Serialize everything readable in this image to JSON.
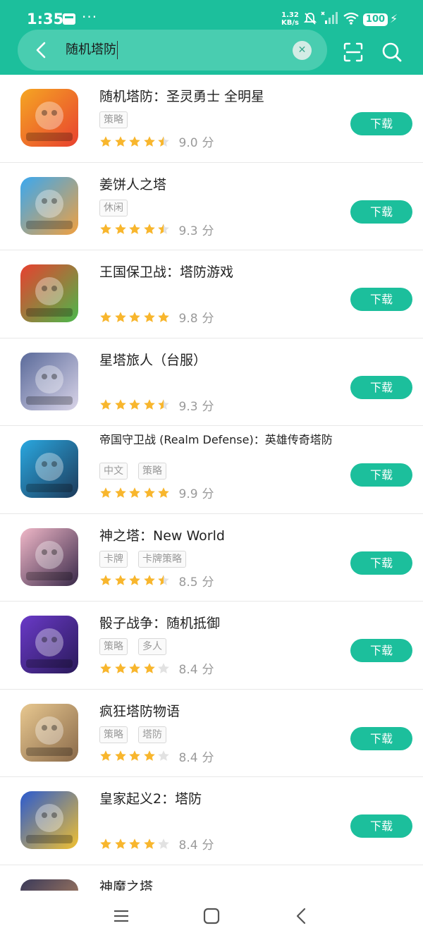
{
  "status": {
    "time": "1:35",
    "speed": "1.32",
    "speed_unit": "KB/s",
    "battery": "100"
  },
  "search": {
    "query": "随机塔防"
  },
  "download_label": "下载",
  "score_unit": "分",
  "apps": [
    {
      "title": "随机塔防：圣灵勇士 全明星",
      "tags": [
        "策略"
      ],
      "rating": 4.5,
      "score": "9.0",
      "icon": "hero-event-icon",
      "colors": [
        "#f5a623",
        "#e8412f"
      ]
    },
    {
      "title": "姜饼人之塔",
      "tags": [
        "休闲"
      ],
      "rating": 4.5,
      "score": "9.3",
      "icon": "gingerbread-adventures-icon",
      "colors": [
        "#3aa8f0",
        "#f0a040"
      ]
    },
    {
      "title": "王国保卫战：塔防游戏",
      "tags": [],
      "rating": 5,
      "score": "9.8",
      "icon": "kingdom-rush-icon",
      "colors": [
        "#e8402f",
        "#4bb84b"
      ]
    },
    {
      "title": "星塔旅人（台服）",
      "tags": [],
      "rating": 4.5,
      "score": "9.3",
      "icon": "anime-girl-icon",
      "colors": [
        "#5a6a9a",
        "#d9d4e8"
      ]
    },
    {
      "title": "帝国守卫战 (Realm Defense)：英雄传奇塔防",
      "tags": [
        "中文",
        "策略"
      ],
      "rating": 5,
      "score": "9.9",
      "icon": "realm-defense-icon",
      "colors": [
        "#2aa8e0",
        "#1d3a5a"
      ]
    },
    {
      "title": "神之塔：New World",
      "tags": [
        "卡牌",
        "卡牌策略"
      ],
      "rating": 4.5,
      "score": "8.5",
      "icon": "netmarble-icon",
      "colors": [
        "#f0b8c8",
        "#3a2a4a"
      ]
    },
    {
      "title": "骰子战争：随机抵御",
      "tags": [
        "策略",
        "多人"
      ],
      "rating": 4,
      "score": "8.4",
      "icon": "dice-icon",
      "colors": [
        "#6a3ac8",
        "#2a1a5a"
      ]
    },
    {
      "title": "疯狂塔防物语",
      "tags": [
        "策略",
        "塔防"
      ],
      "rating": 4,
      "score": "8.4",
      "icon": "crazy-defense-icon",
      "colors": [
        "#e8c890",
        "#8a6a4a"
      ]
    },
    {
      "title": "皇家起义2：塔防",
      "tags": [],
      "rating": 4,
      "score": "8.4",
      "icon": "royal-revolt-icon",
      "colors": [
        "#2a5ad0",
        "#f0c030"
      ]
    },
    {
      "title": "神魔之塔",
      "tags": [],
      "rating": 0,
      "score": "",
      "icon": "tower-of-saviors-icon",
      "colors": [
        "#3a3a5a",
        "#c89060"
      ]
    }
  ],
  "colors": {
    "accent": "#1cbf9c",
    "star_on": "#f8b62d",
    "star_off": "#e2e2e2"
  }
}
